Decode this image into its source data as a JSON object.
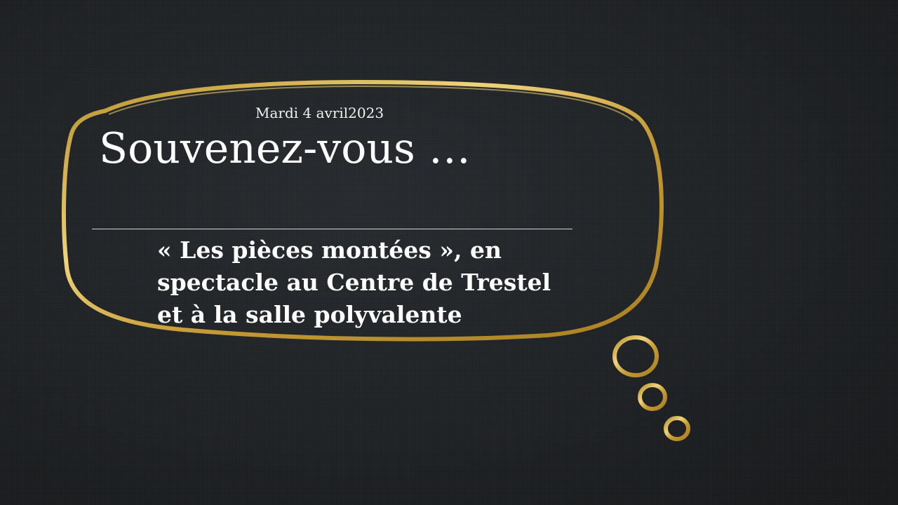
{
  "slide": {
    "date": "Mardi 4 avril2023",
    "title": "Souvenez-vous …",
    "subtitle_lines": [
      "« Les pièces montées », en",
      "spectacle au Centre de Trestel",
      "et à la salle polyvalente"
    ]
  },
  "colors": {
    "background": "#1e2124",
    "accent_gold": "#c9a43a",
    "text": "#ffffff"
  },
  "icons": {
    "bubble": "thought-bubble-outline",
    "dots": "thought-dots"
  }
}
